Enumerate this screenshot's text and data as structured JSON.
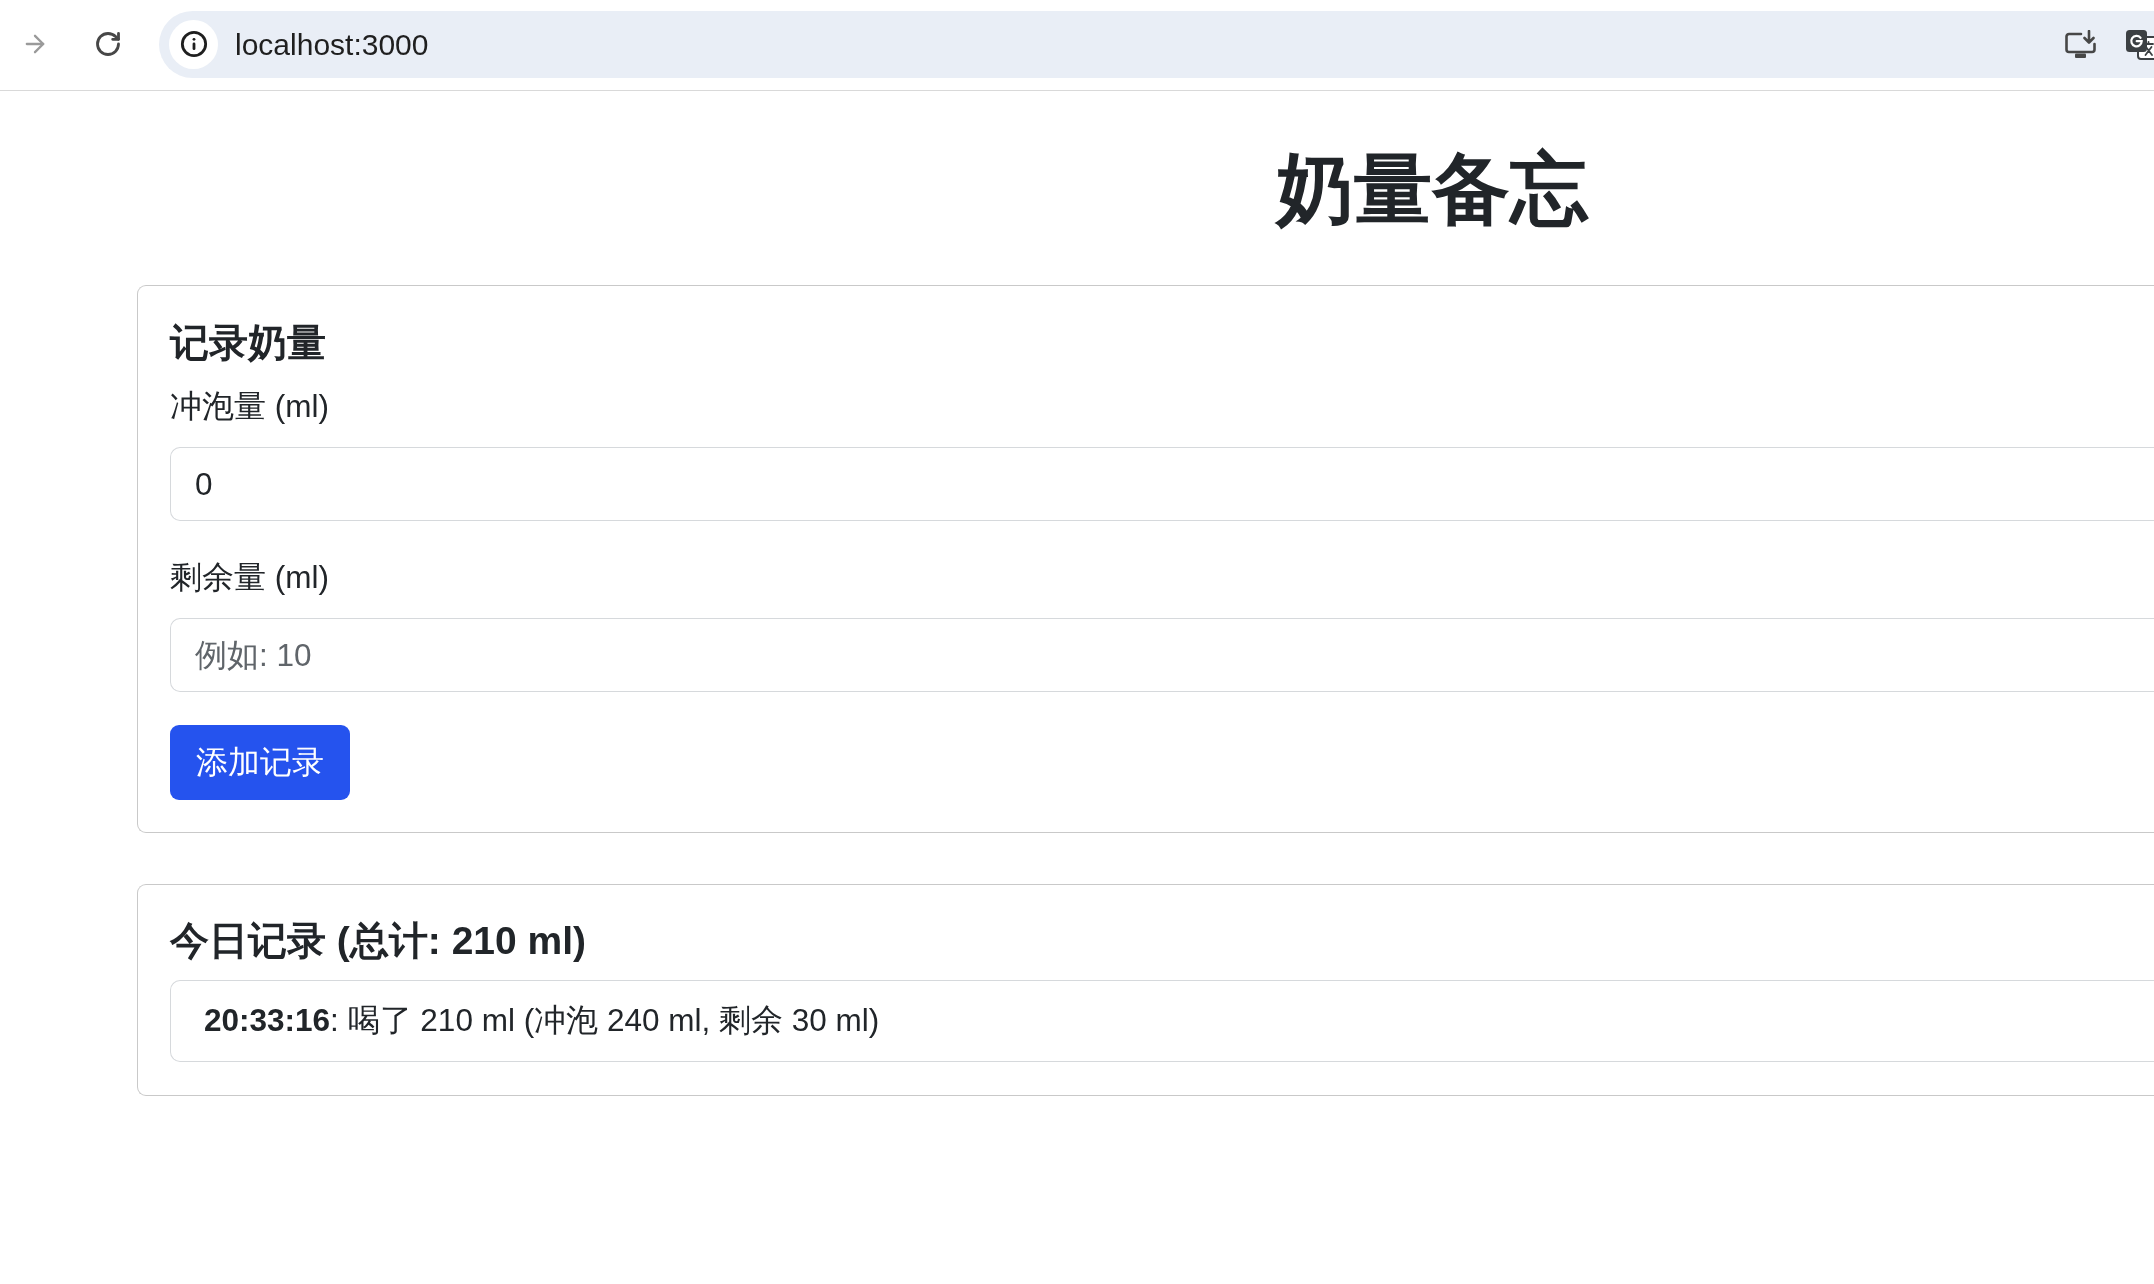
{
  "browser": {
    "forward_button": {
      "disabled": true
    },
    "address": "localhost:3000"
  },
  "page_title": "奶量备忘",
  "record_form": {
    "heading": "记录奶量",
    "fields": [
      {
        "label": "冲泡量 (ml)",
        "value": "0"
      },
      {
        "label": "剩余量 (ml)",
        "placeholder": "例如: 10"
      }
    ],
    "submit_button": {
      "label": "添加记录"
    }
  },
  "today_records": {
    "heading": "今日记录 (总计: 210 ml)",
    "entries": [
      "**20:33:16**: 喝了 210 ml (冲泡 240 ml, 剩余 30 ml)"
    ]
  }
}
